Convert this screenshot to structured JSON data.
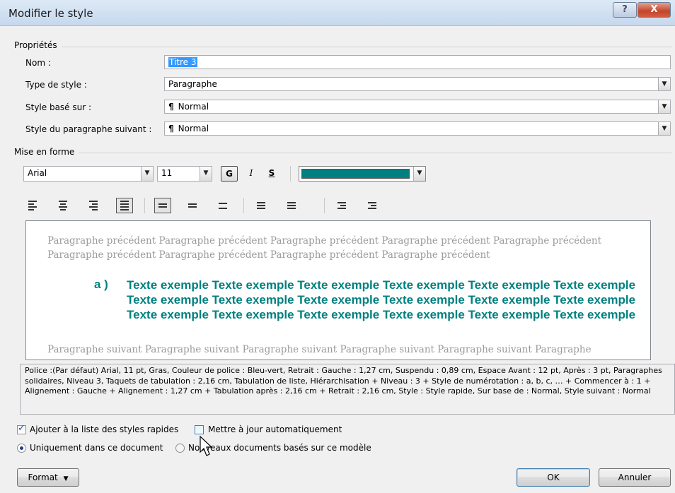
{
  "window": {
    "title": "Modifier le style",
    "help_glyph": "?",
    "close_glyph": "X"
  },
  "properties": {
    "group_label": "Propriétés",
    "name_label": "Nom :",
    "name_value": "Titre 3",
    "type_label": "Type de style :",
    "type_value": "Paragraphe",
    "based_on_label": "Style basé sur :",
    "based_on_value": "Normal",
    "next_label": "Style du paragraphe suivant :",
    "next_value": "Normal",
    "pilcrow": "¶"
  },
  "formatting": {
    "group_label": "Mise en forme",
    "font": "Arial",
    "size": "11",
    "bold": "G",
    "italic": "I",
    "underline": "S",
    "color": "#008080"
  },
  "preview": {
    "previous": "Paragraphe précédent Paragraphe précédent Paragraphe précédent Paragraphe précédent Paragraphe précédent Paragraphe précédent Paragraphe précédent Paragraphe précédent Paragraphe précédent",
    "number": "a )",
    "sample": "Texte exemple Texte exemple Texte exemple Texte exemple Texte exemple Texte exemple Texte exemple Texte exemple Texte exemple Texte exemple Texte exemple Texte exemple Texte exemple Texte exemple Texte exemple Texte exemple Texte exemple Texte exemple",
    "next": "Paragraphe suivant Paragraphe suivant Paragraphe suivant Paragraphe suivant Paragraphe suivant Paragraphe"
  },
  "description": "Police :(Par défaut) Arial, 11 pt, Gras, Couleur de police : Bleu-vert, Retrait : Gauche :  1,27 cm, Suspendu : 0,89 cm, Espace Avant : 12 pt, Après : 3 pt, Paragraphes solidaires, Niveau 3, Taquets de tabulation :  2,16 cm, Tabulation de liste, Hiérarchisation + Niveau : 3 + Style de numérotation : a, b, c, … + Commencer à : 1 + Alignement : Gauche + Alignement :  1,27 cm + Tabulation après :  2,16 cm + Retrait :  2,16 cm, Style : Style rapide, Sur base de : Normal, Style suivant : Normal",
  "options": {
    "add_quick_styles": "Ajouter à la liste des styles rapides",
    "auto_update": "Mettre à jour automatiquement",
    "only_this_doc": "Uniquement dans ce document",
    "new_docs": "Nouveaux documents basés sur ce modèle"
  },
  "buttons": {
    "format": "Format",
    "format_arrow": "▼",
    "ok": "OK",
    "cancel": "Annuler"
  }
}
